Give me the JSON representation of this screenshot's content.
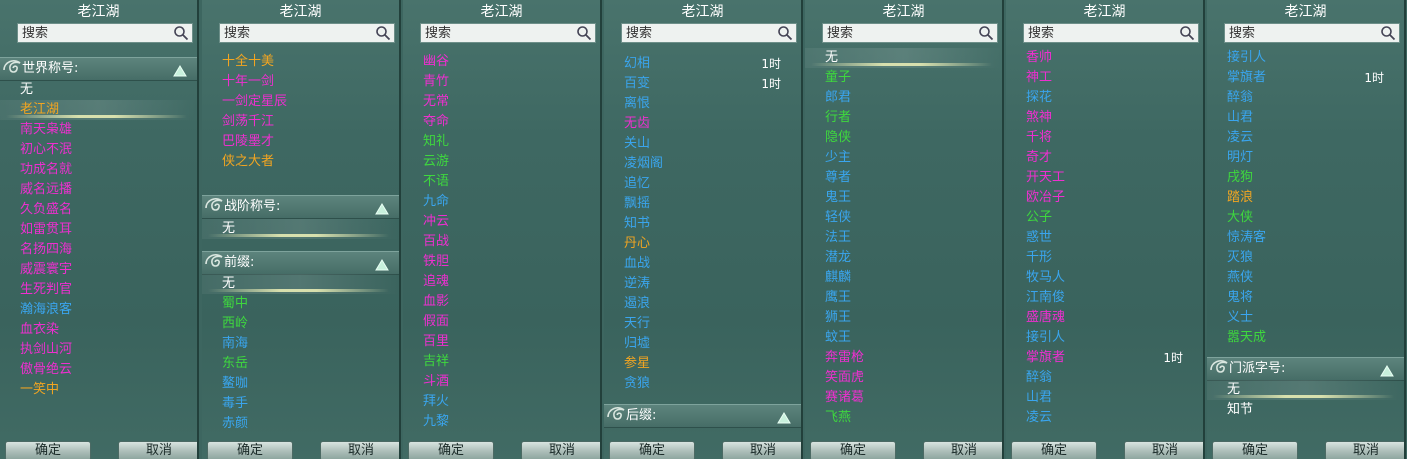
{
  "colors": {
    "gold": "#f2a521",
    "magenta": "#ee2fd0",
    "blue": "#3aa5ee",
    "green": "#3ed83e",
    "white": "#ffffff"
  },
  "common": {
    "title": "老江湖",
    "search_placeholder": "搜索",
    "ok_label": "确定",
    "cancel_label": "取消"
  },
  "panels": [
    {
      "sections": [
        {
          "header": "世界称号:",
          "items": [
            {
              "text": "无",
              "color": "white"
            },
            {
              "text": "老江湖",
              "color": "gold",
              "selected": true
            },
            {
              "text": "南天枭雄",
              "color": "magenta"
            },
            {
              "text": "初心不泯",
              "color": "magenta"
            },
            {
              "text": "功成名就",
              "color": "magenta"
            },
            {
              "text": "威名远播",
              "color": "magenta"
            },
            {
              "text": "久负盛名",
              "color": "magenta"
            },
            {
              "text": "如雷贯耳",
              "color": "magenta"
            },
            {
              "text": "名扬四海",
              "color": "magenta"
            },
            {
              "text": "威震寰宇",
              "color": "magenta"
            },
            {
              "text": "生死判官",
              "color": "magenta"
            },
            {
              "text": "瀚海浪客",
              "color": "blue"
            },
            {
              "text": "血衣染",
              "color": "magenta"
            },
            {
              "text": "执剑山河",
              "color": "magenta"
            },
            {
              "text": "傲骨绝云",
              "color": "magenta"
            },
            {
              "text": "一笑中",
              "color": "gold"
            }
          ]
        }
      ]
    },
    {
      "sections": [
        {
          "header": "",
          "items": [
            {
              "text": "十全十美",
              "color": "gold"
            },
            {
              "text": "十年一剑",
              "color": "magenta"
            },
            {
              "text": "一剑定星辰",
              "color": "magenta"
            },
            {
              "text": "剑荡千江",
              "color": "magenta"
            },
            {
              "text": "巴陵墨才",
              "color": "magenta"
            },
            {
              "text": "侠之大者",
              "color": "gold"
            }
          ]
        },
        {
          "header": "战阶称号:",
          "items": [
            {
              "text": "无",
              "color": "white",
              "selected": true
            }
          ]
        },
        {
          "header": "前缀:",
          "items": [
            {
              "text": "无",
              "color": "white",
              "selected": true
            },
            {
              "text": "蜀中",
              "color": "green"
            },
            {
              "text": "西岭",
              "color": "green"
            },
            {
              "text": "南海",
              "color": "blue"
            },
            {
              "text": "东岳",
              "color": "green"
            },
            {
              "text": "鳌咖",
              "color": "blue"
            },
            {
              "text": "毒手",
              "color": "blue"
            },
            {
              "text": "赤颜",
              "color": "blue"
            }
          ]
        }
      ]
    },
    {
      "sections": [
        {
          "header": "",
          "items": [
            {
              "text": "幽谷",
              "color": "magenta"
            },
            {
              "text": "青竹",
              "color": "magenta"
            },
            {
              "text": "无常",
              "color": "magenta"
            },
            {
              "text": "夺命",
              "color": "magenta"
            },
            {
              "text": "知礼",
              "color": "green"
            },
            {
              "text": "云游",
              "color": "green"
            },
            {
              "text": "不语",
              "color": "green"
            },
            {
              "text": "九命",
              "color": "blue"
            },
            {
              "text": "冲云",
              "color": "magenta"
            },
            {
              "text": "百战",
              "color": "magenta"
            },
            {
              "text": "铁胆",
              "color": "magenta"
            },
            {
              "text": "追魂",
              "color": "magenta"
            },
            {
              "text": "血影",
              "color": "magenta"
            },
            {
              "text": "假面",
              "color": "magenta"
            },
            {
              "text": "百里",
              "color": "magenta"
            },
            {
              "text": "吉祥",
              "color": "green"
            },
            {
              "text": "斗酒",
              "color": "magenta"
            },
            {
              "text": "拜火",
              "color": "blue"
            },
            {
              "text": "九黎",
              "color": "blue"
            }
          ]
        }
      ]
    },
    {
      "sections": [
        {
          "header": "",
          "items": [
            {
              "text": "幻相",
              "color": "blue",
              "time": "1时"
            },
            {
              "text": "百变",
              "color": "blue",
              "time": "1时"
            },
            {
              "text": "离恨",
              "color": "blue"
            },
            {
              "text": "无齿",
              "color": "magenta"
            },
            {
              "text": "关山",
              "color": "blue"
            },
            {
              "text": "凌烟阁",
              "color": "blue"
            },
            {
              "text": "追忆",
              "color": "blue"
            },
            {
              "text": "飘摇",
              "color": "blue"
            },
            {
              "text": "知书",
              "color": "blue"
            },
            {
              "text": "丹心",
              "color": "gold"
            },
            {
              "text": "血战",
              "color": "blue"
            },
            {
              "text": "逆涛",
              "color": "blue"
            },
            {
              "text": "遏浪",
              "color": "blue"
            },
            {
              "text": "天行",
              "color": "blue"
            },
            {
              "text": "归墟",
              "color": "blue"
            },
            {
              "text": "参星",
              "color": "gold"
            },
            {
              "text": "贪狼",
              "color": "blue"
            }
          ]
        },
        {
          "header": "后缀:",
          "items": []
        }
      ]
    },
    {
      "sections": [
        {
          "header": "",
          "items": [
            {
              "text": "无",
              "color": "white",
              "selected": true
            },
            {
              "text": "童子",
              "color": "green"
            },
            {
              "text": "郎君",
              "color": "blue"
            },
            {
              "text": "行者",
              "color": "green"
            },
            {
              "text": "隐侠",
              "color": "green"
            },
            {
              "text": "少主",
              "color": "blue"
            },
            {
              "text": "尊者",
              "color": "blue"
            },
            {
              "text": "鬼王",
              "color": "blue"
            },
            {
              "text": "轻侠",
              "color": "blue"
            },
            {
              "text": "法王",
              "color": "blue"
            },
            {
              "text": "潜龙",
              "color": "blue"
            },
            {
              "text": "麒麟",
              "color": "blue"
            },
            {
              "text": "鹰王",
              "color": "blue"
            },
            {
              "text": "狮王",
              "color": "blue"
            },
            {
              "text": "蚊王",
              "color": "blue"
            },
            {
              "text": "奔雷枪",
              "color": "magenta"
            },
            {
              "text": "笑面虎",
              "color": "magenta"
            },
            {
              "text": "赛诸葛",
              "color": "magenta"
            },
            {
              "text": "飞燕",
              "color": "green"
            }
          ]
        }
      ]
    },
    {
      "sections": [
        {
          "header": "",
          "items": [
            {
              "text": "香帅",
              "color": "magenta"
            },
            {
              "text": "神工",
              "color": "magenta"
            },
            {
              "text": "探花",
              "color": "blue"
            },
            {
              "text": "煞神",
              "color": "magenta"
            },
            {
              "text": "千将",
              "color": "magenta"
            },
            {
              "text": "奇才",
              "color": "magenta"
            },
            {
              "text": "开天工",
              "color": "magenta"
            },
            {
              "text": "欧冶子",
              "color": "magenta"
            },
            {
              "text": "公子",
              "color": "green"
            },
            {
              "text": "惑世",
              "color": "blue"
            },
            {
              "text": "千形",
              "color": "blue"
            },
            {
              "text": "牧马人",
              "color": "blue"
            },
            {
              "text": "江南俊",
              "color": "blue"
            },
            {
              "text": "盛唐魂",
              "color": "magenta"
            },
            {
              "text": "接引人",
              "color": "blue"
            },
            {
              "text": "掌旗者",
              "color": "magenta",
              "time": "1时"
            },
            {
              "text": "醉翁",
              "color": "blue"
            },
            {
              "text": "山君",
              "color": "blue"
            },
            {
              "text": "凌云",
              "color": "blue"
            }
          ]
        }
      ]
    },
    {
      "sections": [
        {
          "header": "",
          "items": [
            {
              "text": "接引人",
              "color": "blue"
            },
            {
              "text": "掌旗者",
              "color": "blue",
              "time": "1时"
            },
            {
              "text": "醉翁",
              "color": "blue"
            },
            {
              "text": "山君",
              "color": "blue"
            },
            {
              "text": "凌云",
              "color": "blue"
            },
            {
              "text": "明灯",
              "color": "blue"
            },
            {
              "text": "戌狗",
              "color": "green"
            },
            {
              "text": "踏浪",
              "color": "gold"
            },
            {
              "text": "大侠",
              "color": "green"
            },
            {
              "text": "惊涛客",
              "color": "blue"
            },
            {
              "text": "灭狼",
              "color": "blue"
            },
            {
              "text": "燕侠",
              "color": "blue"
            },
            {
              "text": "鬼将",
              "color": "blue"
            },
            {
              "text": "义士",
              "color": "blue"
            },
            {
              "text": "嚣天成",
              "color": "green"
            }
          ]
        },
        {
          "header": "门派字号:",
          "items": [
            {
              "text": "无",
              "color": "white",
              "selected": true
            },
            {
              "text": "知节",
              "color": "white"
            }
          ]
        }
      ]
    }
  ]
}
